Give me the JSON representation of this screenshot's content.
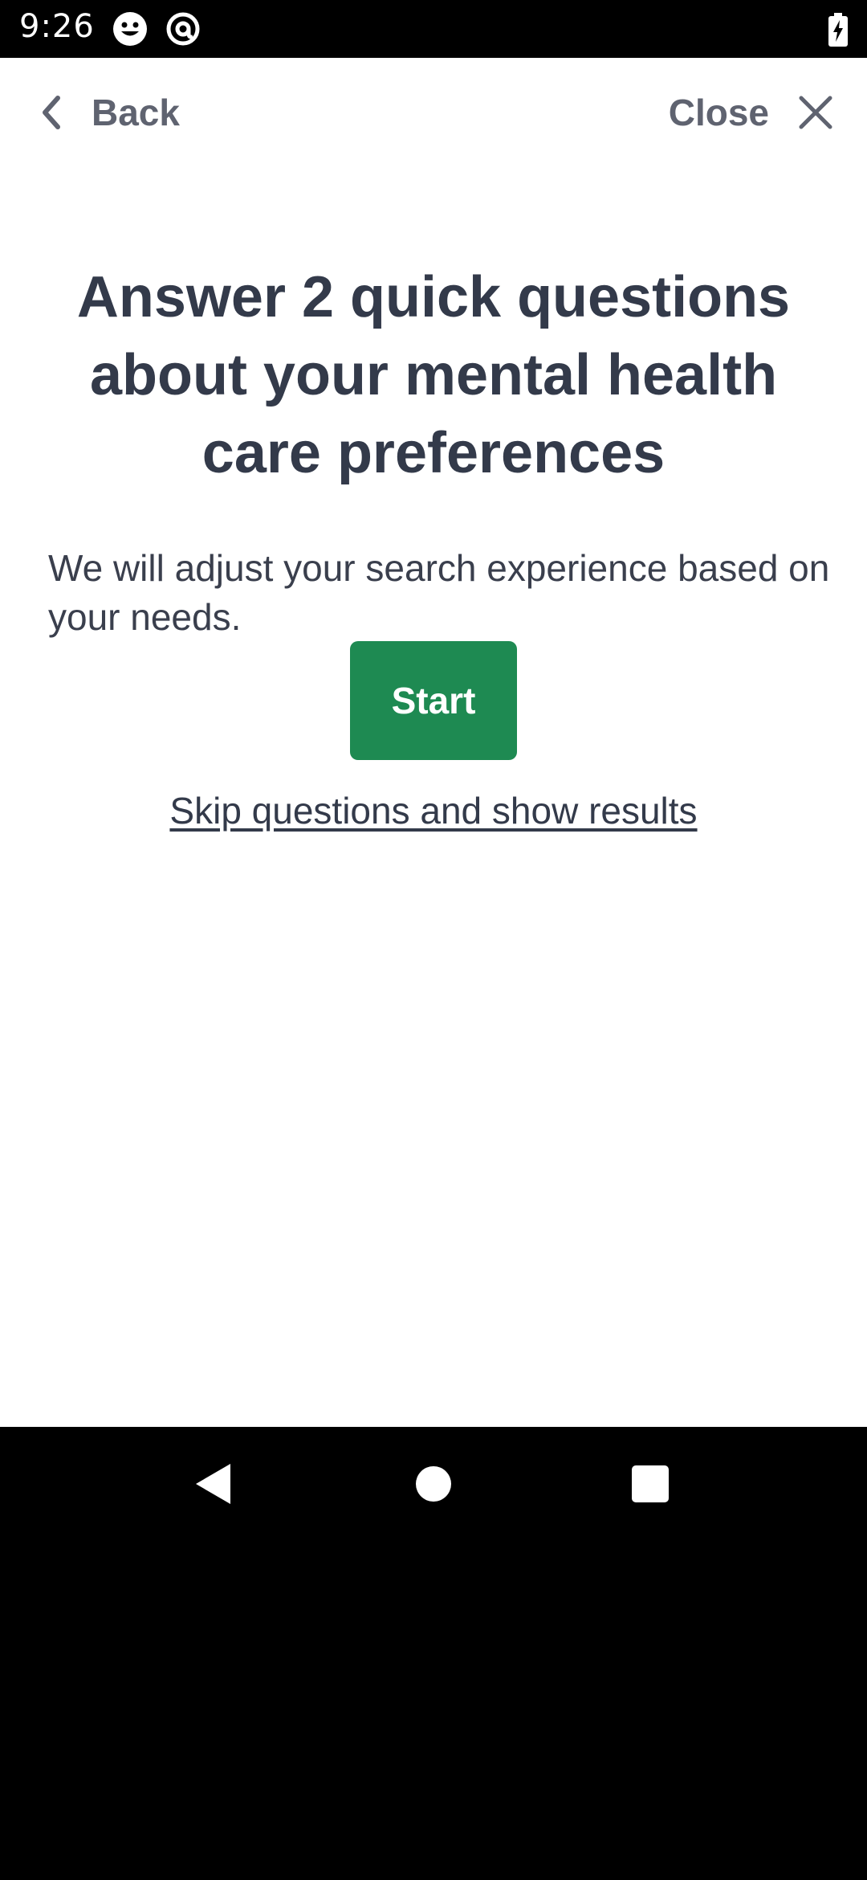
{
  "status_bar": {
    "time": "9:26",
    "icons": [
      "smiley-icon",
      "at-sign-icon",
      "battery-charging-icon"
    ]
  },
  "top_nav": {
    "back_label": "Back",
    "close_label": "Close"
  },
  "content": {
    "heading": "Answer 2 quick questions about your mental health care preferences",
    "description": "We will adjust your search experience based on your needs.",
    "start_label": "Start",
    "skip_label": "Skip questions and show results"
  },
  "nav_bar": {
    "buttons": [
      "back-triangle-icon",
      "home-circle-icon",
      "recents-square-icon"
    ]
  },
  "colors": {
    "primary_button": "#1e8a52",
    "heading_text": "#333a4a",
    "nav_text": "#5f6370"
  }
}
